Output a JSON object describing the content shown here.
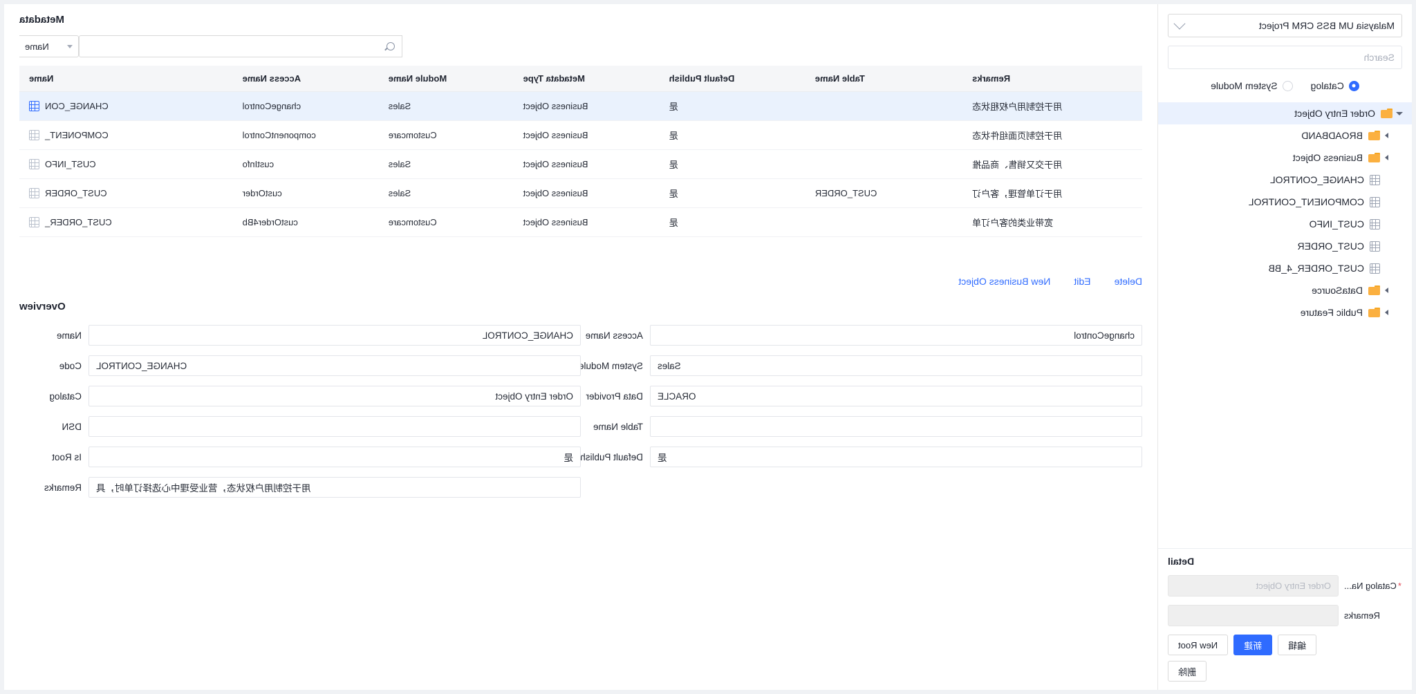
{
  "catalog_panel": {
    "project_selector": {
      "value": "Malaysia UM BSS CRM Project",
      "icon": "chevron-down-icon"
    },
    "search": {
      "placeholder": "Search",
      "value": ""
    },
    "radios": [
      {
        "label": "Catalog",
        "selected": true
      },
      {
        "label": "System Module",
        "selected": false
      }
    ],
    "tree": [
      {
        "label": "Order Entry Object",
        "type": "folder",
        "expanded": true,
        "selected": true,
        "depth": 0
      },
      {
        "label": "BROADBAND",
        "type": "folder",
        "expanded": false,
        "selected": false,
        "depth": 1
      },
      {
        "label": "Business Object",
        "type": "folder",
        "expanded": false,
        "selected": false,
        "depth": 1
      },
      {
        "label": "CHANGE_CONTROL",
        "type": "table",
        "expanded": false,
        "selected": false,
        "depth": 1
      },
      {
        "label": "COMPONENT_CONTROL",
        "type": "table",
        "expanded": false,
        "selected": false,
        "depth": 1
      },
      {
        "label": "CUST_INFO",
        "type": "table",
        "expanded": false,
        "selected": false,
        "depth": 1
      },
      {
        "label": "CUST_ORDER",
        "type": "table",
        "expanded": false,
        "selected": false,
        "depth": 1
      },
      {
        "label": "CUST_ORDER_4_BB",
        "type": "table",
        "expanded": false,
        "selected": false,
        "depth": 1
      },
      {
        "label": "DataSource",
        "type": "folder",
        "expanded": false,
        "selected": false,
        "depth": 1
      },
      {
        "label": "Public Feature",
        "type": "folder",
        "expanded": false,
        "selected": false,
        "depth": 1
      }
    ],
    "detail": {
      "title": "Detail",
      "fields": [
        {
          "label": "Catalog Na...",
          "required": true,
          "value": "",
          "placeholder": "Order Entry Object"
        },
        {
          "label": "Remarks",
          "required": false,
          "value": "",
          "placeholder": ""
        }
      ],
      "buttons": [
        {
          "label": "New Root",
          "style": "default"
        },
        {
          "label": "新建",
          "style": "primary"
        },
        {
          "label": "编辑",
          "style": "default"
        },
        {
          "label": "删除",
          "style": "default"
        }
      ]
    }
  },
  "metadata_panel": {
    "title": "Metadata",
    "filter": {
      "select_value": "Name",
      "select_icon": "chevron-down-icon",
      "search_icon": "search-icon",
      "search_value": "",
      "search_placeholder": ""
    },
    "table": {
      "columns": [
        "Name",
        "Access Name",
        "Module Name",
        "Metadata Type",
        "Default Publish",
        "Table Name",
        "Remarks"
      ],
      "rows": [
        {
          "selected": true,
          "icon": "table-icon-active",
          "name": "CHANGE_CON",
          "access_name": "changeControl",
          "module_name": "Sales",
          "metadata_type": "Business Object",
          "default_publish": "是",
          "table_name": "",
          "remarks": "用于控制用户权租状态"
        },
        {
          "selected": false,
          "icon": "table-icon",
          "name": "COMPONENT_",
          "access_name": "componentControl",
          "module_name": "Customcare",
          "metadata_type": "Business Object",
          "default_publish": "是",
          "table_name": "",
          "remarks": "用于控制页面组件状态"
        },
        {
          "selected": false,
          "icon": "table-icon",
          "name": "CUST_INFO",
          "access_name": "custInfo",
          "module_name": "Sales",
          "metadata_type": "Business Object",
          "default_publish": "是",
          "table_name": "",
          "remarks": "用于交又销售、商品推"
        },
        {
          "selected": false,
          "icon": "table-icon",
          "name": "CUST_ORDER",
          "access_name": "custOrder",
          "module_name": "Sales",
          "metadata_type": "Business Object",
          "default_publish": "是",
          "table_name": "CUST_ORDER",
          "remarks": "用于订单管理，客户订"
        },
        {
          "selected": false,
          "icon": "table-icon",
          "name": "CUST_ORDER_",
          "access_name": "custOrder4Bb",
          "module_name": "Customcare",
          "metadata_type": "Business Object",
          "default_publish": "是",
          "table_name": "",
          "remarks": "宽带业类的客户订单"
        }
      ]
    },
    "actions": [
      {
        "label": "New Business Object"
      },
      {
        "label": "Edit"
      },
      {
        "label": "Delete"
      }
    ],
    "overview": {
      "title": "Overview",
      "left_column": [
        {
          "label": "Name",
          "value": "CHANGE_CONTROL",
          "align": "left"
        },
        {
          "label": "Code",
          "value": "CHANGE_CONTROL",
          "align": "right"
        },
        {
          "label": "Catalog",
          "value": "Order Entry Object",
          "align": "left"
        },
        {
          "label": "DSN",
          "value": "",
          "align": "left"
        },
        {
          "label": "Is Root",
          "value": "是",
          "align": "left"
        },
        {
          "label": "Remarks",
          "value": "用于控制用户权状态，营业受理中心选择订单时，具",
          "align": "right"
        }
      ],
      "right_column": [
        {
          "label": "Access Name",
          "value": "changeControl",
          "align": "left"
        },
        {
          "label": "System Module",
          "value": "Sales",
          "align": "right"
        },
        {
          "label": "Data Provider",
          "value": "ORACLE",
          "align": "right"
        },
        {
          "label": "Table Name",
          "value": "",
          "align": "left"
        },
        {
          "label": "Default Publish",
          "value": "是",
          "align": "right"
        }
      ]
    }
  },
  "colors": {
    "accent": "#2f6bff",
    "selected_row": "#eaf2fd",
    "folder": "#fbb040",
    "required": "#e34d59"
  }
}
